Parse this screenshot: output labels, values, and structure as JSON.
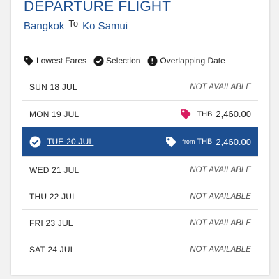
{
  "header": {
    "title": "DEPARTURE FLIGHT",
    "origin": "Bangkok",
    "to_label": "To",
    "destination": "Ko Samui"
  },
  "legend": [
    {
      "icon": "tag-icon",
      "label": "Lowest Fares"
    },
    {
      "icon": "check-circle-icon",
      "label": "Selection"
    },
    {
      "icon": "exclamation-circle-icon",
      "label": "Overlapping Date"
    }
  ],
  "dates": [
    {
      "date": "SUN 18 JUL",
      "status": "NOT AVAILABLE"
    },
    {
      "date": "MON 19 JUL",
      "currency": "THB",
      "amount": "2,460.00",
      "lowest_fare": true
    },
    {
      "date": "TUE 20 JUL",
      "from_label": "from",
      "currency": "THB",
      "amount": "2,460.00",
      "selected": true
    },
    {
      "date": "WED 21 JUL",
      "status": "NOT AVAILABLE"
    },
    {
      "date": "THU 22 JUL",
      "status": "NOT AVAILABLE"
    },
    {
      "date": "FRI 23 JUL",
      "status": "NOT AVAILABLE"
    },
    {
      "date": "SAT 24 JUL",
      "status": "NOT AVAILABLE"
    }
  ],
  "colors": {
    "brand_blue": "#1d4f91",
    "lowest_fare_tag": "#d81b60"
  }
}
